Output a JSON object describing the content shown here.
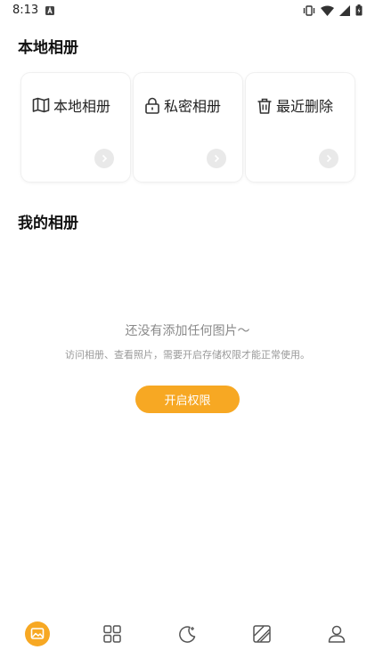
{
  "status_bar": {
    "time": "8:13",
    "icons": [
      "notification-a-icon",
      "vibrate-icon",
      "wifi-icon",
      "signal-icon",
      "battery-icon"
    ]
  },
  "sections": {
    "local_title": "本地相册",
    "mine_title": "我的相册"
  },
  "cards": [
    {
      "label": "本地相册",
      "icon": "map-icon"
    },
    {
      "label": "私密相册",
      "icon": "lock-icon"
    },
    {
      "label": "最近删除",
      "icon": "trash-icon"
    }
  ],
  "empty_state": {
    "title": "还没有添加任何图片～",
    "description": "访问相册、查看照片，需要开启存储权限才能正常使用。",
    "button_label": "开启权限"
  },
  "tab_bar": {
    "tabs": [
      "gallery-icon",
      "grid-icon",
      "moon-icon",
      "stripes-icon",
      "profile-icon"
    ],
    "active_index": 0,
    "accent_color": "#f7a823"
  }
}
